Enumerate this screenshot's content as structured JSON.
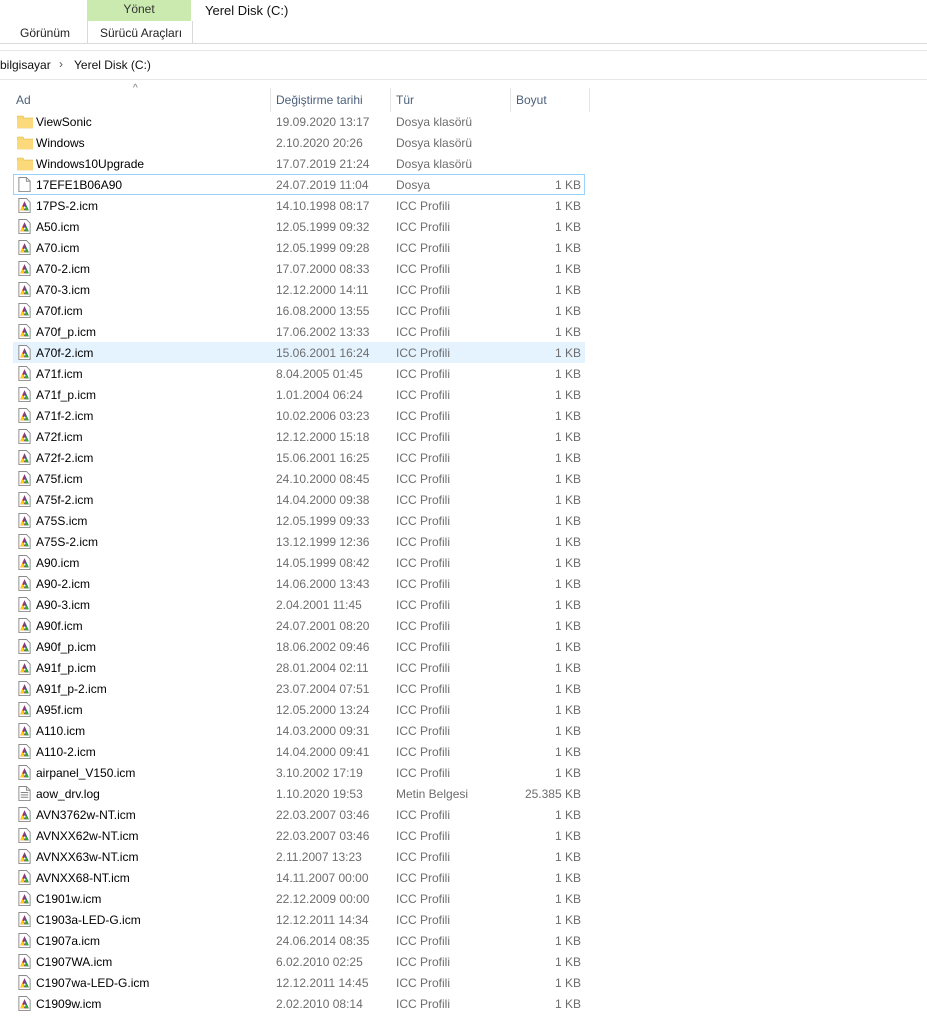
{
  "ribbon": {
    "context_tab": "Yönet",
    "window_title": "Yerel Disk (C:)",
    "tabs": [
      "Görünüm",
      "Sürücü Araçları"
    ]
  },
  "address": {
    "crumbs": [
      "bilgisayar",
      "Yerel Disk (C:)"
    ],
    "separator": "›"
  },
  "columns": {
    "name": "Ad",
    "date": "Değiştirme tarihi",
    "type": "Tür",
    "size": "Boyut",
    "sort_indicator": "^"
  },
  "colors": {
    "folder": "#f8d775",
    "context_tab": "#cbeab0",
    "selection": "#e5f3ff",
    "selection_border": "#99d1ff"
  },
  "files": [
    {
      "name": "ViewSonic",
      "date": "19.09.2020 13:17",
      "type": "Dosya klasörü",
      "size": "",
      "icon": "folder-icon"
    },
    {
      "name": "Windows",
      "date": "2.10.2020 20:26",
      "type": "Dosya klasörü",
      "size": "",
      "icon": "folder-icon"
    },
    {
      "name": "Windows10Upgrade",
      "date": "17.07.2019 21:24",
      "type": "Dosya klasörü",
      "size": "",
      "icon": "folder-icon"
    },
    {
      "name": "17EFE1B06A90",
      "date": "24.07.2019 11:04",
      "type": "Dosya",
      "size": "1 KB",
      "icon": "blank-file-icon"
    },
    {
      "name": "17PS-2.icm",
      "date": "14.10.1998 08:17",
      "type": "ICC Profili",
      "size": "1 KB",
      "icon": "icc-profile-icon"
    },
    {
      "name": "A50.icm",
      "date": "12.05.1999 09:32",
      "type": "ICC Profili",
      "size": "1 KB",
      "icon": "icc-profile-icon"
    },
    {
      "name": "A70.icm",
      "date": "12.05.1999 09:28",
      "type": "ICC Profili",
      "size": "1 KB",
      "icon": "icc-profile-icon"
    },
    {
      "name": "A70-2.icm",
      "date": "17.07.2000 08:33",
      "type": "ICC Profili",
      "size": "1 KB",
      "icon": "icc-profile-icon"
    },
    {
      "name": "A70-3.icm",
      "date": "12.12.2000 14:11",
      "type": "ICC Profili",
      "size": "1 KB",
      "icon": "icc-profile-icon"
    },
    {
      "name": "A70f.icm",
      "date": "16.08.2000 13:55",
      "type": "ICC Profili",
      "size": "1 KB",
      "icon": "icc-profile-icon"
    },
    {
      "name": "A70f_p.icm",
      "date": "17.06.2002 13:33",
      "type": "ICC Profili",
      "size": "1 KB",
      "icon": "icc-profile-icon"
    },
    {
      "name": "A70f-2.icm",
      "date": "15.06.2001 16:24",
      "type": "ICC Profili",
      "size": "1 KB",
      "icon": "icc-profile-icon"
    },
    {
      "name": "A71f.icm",
      "date": "8.04.2005 01:45",
      "type": "ICC Profili",
      "size": "1 KB",
      "icon": "icc-profile-icon"
    },
    {
      "name": "A71f_p.icm",
      "date": "1.01.2004 06:24",
      "type": "ICC Profili",
      "size": "1 KB",
      "icon": "icc-profile-icon"
    },
    {
      "name": "A71f-2.icm",
      "date": "10.02.2006 03:23",
      "type": "ICC Profili",
      "size": "1 KB",
      "icon": "icc-profile-icon"
    },
    {
      "name": "A72f.icm",
      "date": "12.12.2000 15:18",
      "type": "ICC Profili",
      "size": "1 KB",
      "icon": "icc-profile-icon"
    },
    {
      "name": "A72f-2.icm",
      "date": "15.06.2001 16:25",
      "type": "ICC Profili",
      "size": "1 KB",
      "icon": "icc-profile-icon"
    },
    {
      "name": "A75f.icm",
      "date": "24.10.2000 08:45",
      "type": "ICC Profili",
      "size": "1 KB",
      "icon": "icc-profile-icon"
    },
    {
      "name": "A75f-2.icm",
      "date": "14.04.2000 09:38",
      "type": "ICC Profili",
      "size": "1 KB",
      "icon": "icc-profile-icon"
    },
    {
      "name": "A75S.icm",
      "date": "12.05.1999 09:33",
      "type": "ICC Profili",
      "size": "1 KB",
      "icon": "icc-profile-icon"
    },
    {
      "name": "A75S-2.icm",
      "date": "13.12.1999 12:36",
      "type": "ICC Profili",
      "size": "1 KB",
      "icon": "icc-profile-icon"
    },
    {
      "name": "A90.icm",
      "date": "14.05.1999 08:42",
      "type": "ICC Profili",
      "size": "1 KB",
      "icon": "icc-profile-icon"
    },
    {
      "name": "A90-2.icm",
      "date": "14.06.2000 13:43",
      "type": "ICC Profili",
      "size": "1 KB",
      "icon": "icc-profile-icon"
    },
    {
      "name": "A90-3.icm",
      "date": "2.04.2001 11:45",
      "type": "ICC Profili",
      "size": "1 KB",
      "icon": "icc-profile-icon"
    },
    {
      "name": "A90f.icm",
      "date": "24.07.2001 08:20",
      "type": "ICC Profili",
      "size": "1 KB",
      "icon": "icc-profile-icon"
    },
    {
      "name": "A90f_p.icm",
      "date": "18.06.2002 09:46",
      "type": "ICC Profili",
      "size": "1 KB",
      "icon": "icc-profile-icon"
    },
    {
      "name": "A91f_p.icm",
      "date": "28.01.2004 02:11",
      "type": "ICC Profili",
      "size": "1 KB",
      "icon": "icc-profile-icon"
    },
    {
      "name": "A91f_p-2.icm",
      "date": "23.07.2004 07:51",
      "type": "ICC Profili",
      "size": "1 KB",
      "icon": "icc-profile-icon"
    },
    {
      "name": "A95f.icm",
      "date": "12.05.2000 13:24",
      "type": "ICC Profili",
      "size": "1 KB",
      "icon": "icc-profile-icon"
    },
    {
      "name": "A110.icm",
      "date": "14.03.2000 09:31",
      "type": "ICC Profili",
      "size": "1 KB",
      "icon": "icc-profile-icon"
    },
    {
      "name": "A110-2.icm",
      "date": "14.04.2000 09:41",
      "type": "ICC Profili",
      "size": "1 KB",
      "icon": "icc-profile-icon"
    },
    {
      "name": "airpanel_V150.icm",
      "date": "3.10.2002 17:19",
      "type": "ICC Profili",
      "size": "1 KB",
      "icon": "icc-profile-icon"
    },
    {
      "name": "aow_drv.log",
      "date": "1.10.2020 19:53",
      "type": "Metin Belgesi",
      "size": "25.385 KB",
      "icon": "text-document-icon"
    },
    {
      "name": "AVN3762w-NT.icm",
      "date": "22.03.2007 03:46",
      "type": "ICC Profili",
      "size": "1 KB",
      "icon": "icc-profile-icon"
    },
    {
      "name": "AVNXX62w-NT.icm",
      "date": "22.03.2007 03:46",
      "type": "ICC Profili",
      "size": "1 KB",
      "icon": "icc-profile-icon"
    },
    {
      "name": "AVNXX63w-NT.icm",
      "date": "2.11.2007 13:23",
      "type": "ICC Profili",
      "size": "1 KB",
      "icon": "icc-profile-icon"
    },
    {
      "name": "AVNXX68-NT.icm",
      "date": "14.11.2007 00:00",
      "type": "ICC Profili",
      "size": "1 KB",
      "icon": "icc-profile-icon"
    },
    {
      "name": "C1901w.icm",
      "date": "22.12.2009 00:00",
      "type": "ICC Profili",
      "size": "1 KB",
      "icon": "icc-profile-icon"
    },
    {
      "name": "C1903a-LED-G.icm",
      "date": "12.12.2011 14:34",
      "type": "ICC Profili",
      "size": "1 KB",
      "icon": "icc-profile-icon"
    },
    {
      "name": "C1907a.icm",
      "date": "24.06.2014 08:35",
      "type": "ICC Profili",
      "size": "1 KB",
      "icon": "icc-profile-icon"
    },
    {
      "name": "C1907WA.icm",
      "date": "6.02.2010 02:25",
      "type": "ICC Profili",
      "size": "1 KB",
      "icon": "icc-profile-icon"
    },
    {
      "name": "C1907wa-LED-G.icm",
      "date": "12.12.2011 14:45",
      "type": "ICC Profili",
      "size": "1 KB",
      "icon": "icc-profile-icon"
    },
    {
      "name": "C1909w.icm",
      "date": "2.02.2010 08:14",
      "type": "ICC Profili",
      "size": "1 KB",
      "icon": "icc-profile-icon"
    }
  ],
  "selected_index": 3,
  "hover_index": 11
}
